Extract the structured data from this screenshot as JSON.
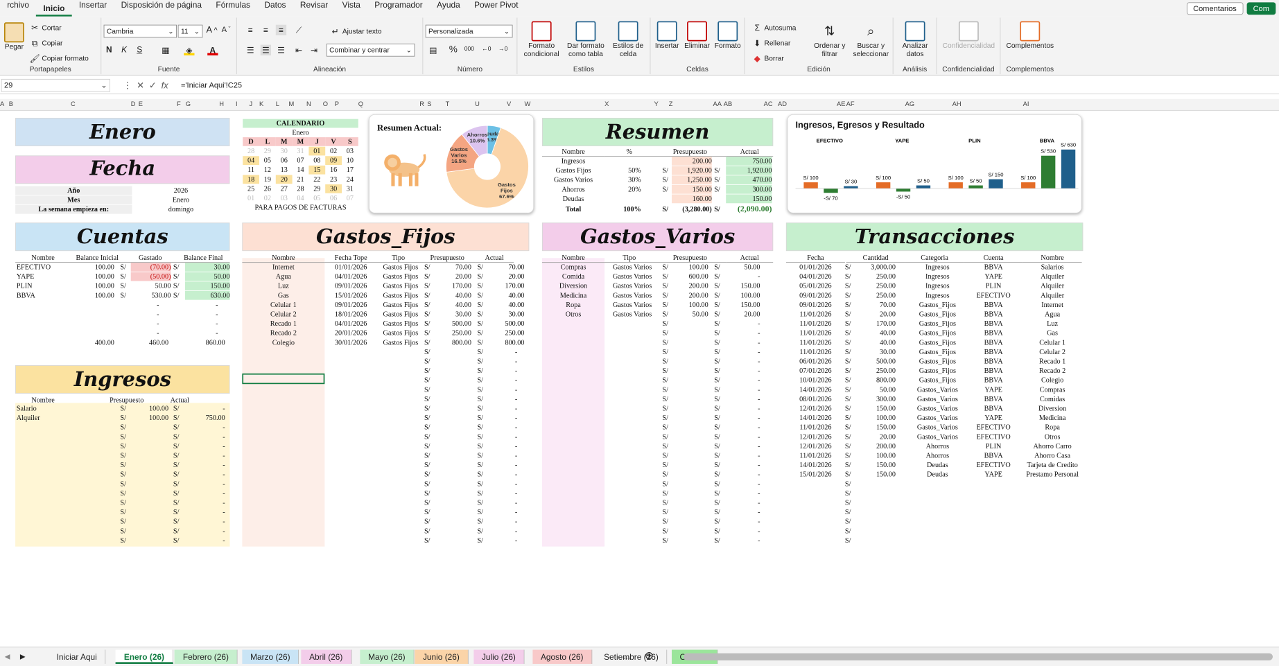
{
  "menu": [
    "rchivo",
    "Inicio",
    "Insertar",
    "Disposición de página",
    "Fórmulas",
    "Datos",
    "Revisar",
    "Vista",
    "Programador",
    "Ayuda",
    "Power Pivot"
  ],
  "topbtns": {
    "comments": "Comentarios",
    "share": "Com"
  },
  "ribbon": {
    "paste": "Pegar",
    "cut": "Cortar",
    "copy": "Copiar",
    "copy_format": "Copiar formato",
    "g_clip": "Portapapeles",
    "font": "Cambria",
    "size": "11",
    "g_font": "Fuente",
    "wrap": "Ajustar texto",
    "merge": "Combinar y centrar",
    "g_align": "Alineación",
    "numfmt": "Personalizada",
    "g_num": "Número",
    "cond": "Formato\ncondicional",
    "astable": "Dar formato\ncomo tabla",
    "cellstyles": "Estilos de\ncelda",
    "g_styles": "Estilos",
    "insert": "Insertar",
    "delete": "Eliminar",
    "format": "Formato",
    "g_cells": "Celdas",
    "autosum": "Autosuma",
    "fill": "Rellenar",
    "clear": "Borrar",
    "sort": "Ordenar y\nfiltrar",
    "find": "Buscar y\nseleccionar",
    "g_edit": "Edición",
    "analyze": "Analizar\ndatos",
    "g_analysis": "Análisis",
    "conf": "Confidencialidad",
    "g_conf": "Confidencialidad",
    "addins": "Complementos",
    "g_addins": "Complementos"
  },
  "formula": {
    "name": "29",
    "fx": "fx",
    "value": "='Iniciar Aqui'!C25"
  },
  "cols": [
    "A",
    "B",
    "C",
    "D",
    "E",
    "F",
    "G",
    "H",
    "I",
    "J",
    "K",
    "L",
    "M",
    "N",
    "O",
    "P",
    "Q",
    "R",
    "S",
    "T",
    "U",
    "V",
    "W",
    "X",
    "Y",
    "Z",
    "AA",
    "AB",
    "AC",
    "AD",
    "AE",
    "AF",
    "AG",
    "AH",
    "AI"
  ],
  "enero": "Enero",
  "fecha": {
    "title": "Fecha",
    "rows": [
      [
        "Año",
        "2026"
      ],
      [
        "Mes",
        "Enero"
      ],
      [
        "La semana empieza en:",
        "domingo"
      ]
    ]
  },
  "calendar": {
    "title": "CALENDARIO",
    "month": "Enero",
    "days": [
      "D",
      "L",
      "M",
      "M",
      "J",
      "V",
      "S"
    ],
    "weeks": [
      [
        "28",
        "29",
        "30",
        "31",
        "01",
        "02",
        "03"
      ],
      [
        "04",
        "05",
        "06",
        "07",
        "08",
        "09",
        "10"
      ],
      [
        "11",
        "12",
        "13",
        "14",
        "15",
        "16",
        "17"
      ],
      [
        "18",
        "19",
        "20",
        "21",
        "22",
        "23",
        "24"
      ],
      [
        "25",
        "26",
        "27",
        "28",
        "29",
        "30",
        "31"
      ],
      [
        "01",
        "02",
        "03",
        "04",
        "05",
        "06",
        "07"
      ]
    ],
    "footer": "PARA PAGOS DE FACTURAS"
  },
  "resumen_actual": {
    "title": "Resumen Actual:",
    "slices": [
      {
        "label": "Gastos Fijos",
        "value": 67.6,
        "color": "#fbd4a8"
      },
      {
        "label": "Gastos Varios",
        "value": 16.5,
        "color": "#f4a582"
      },
      {
        "label": "Ahorros",
        "value": 10.6,
        "color": "#dcc4ef"
      },
      {
        "label": "Deudas",
        "value": 5.3,
        "color": "#6cc0e5"
      }
    ],
    "labels": [
      "Gastos\nFijos\n67.6%",
      "Gastos\nVarios\n16.5%",
      "Ahorros\n10.6%",
      "Deudas\n5.3%"
    ]
  },
  "resumen": {
    "title": "Resumen",
    "headers": [
      "Nombre",
      "%",
      "Presupuesto",
      "Actual"
    ],
    "rows": [
      [
        "Ingresos",
        "",
        "",
        "200.00",
        "750.00"
      ],
      [
        "Gastos Fijos",
        "50%",
        "S/",
        "1,920.00",
        "1,920.00"
      ],
      [
        "Gastos Varios",
        "30%",
        "S/",
        "1,250.00",
        "470.00"
      ],
      [
        "Ahorros",
        "20%",
        "S/",
        "150.00",
        "300.00"
      ],
      [
        "Deudas",
        "",
        "",
        "160.00",
        "150.00"
      ]
    ],
    "total": [
      "Total",
      "100%",
      "S/",
      "(3,280.00)",
      "(2,090.00)"
    ]
  },
  "chart_data": {
    "type": "bar",
    "title": "Ingresos, Egresos y Resultado",
    "categories": [
      "EFECTIVO",
      "YAPE",
      "PLIN",
      "BBVA"
    ],
    "series": [
      {
        "values": [
          100,
          100,
          100,
          100
        ],
        "color": "#e46c26"
      },
      {
        "values": [
          -70,
          -50,
          50,
          530
        ],
        "color": "#2e7d32"
      },
      {
        "values": [
          30,
          50,
          150,
          630
        ],
        "color": "#1f5f8b"
      }
    ],
    "labels": [
      [
        "S/ 100",
        "-S/ 70",
        "S/ 30"
      ],
      [
        "S/ 100",
        "-S/ 50",
        "S/ 50"
      ],
      [
        "S/ 100",
        "S/ 50",
        "S/ 150"
      ],
      [
        "S/ 100",
        "S/ 530",
        "S/ 630"
      ]
    ]
  },
  "cuentas": {
    "title": "Cuentas",
    "headers": [
      "Nombre",
      "Balance Inicial",
      "Gastado",
      "Balance Final"
    ],
    "rows": [
      [
        "EFECTIVO",
        "100.00",
        "(70.00)",
        "30.00"
      ],
      [
        "YAPE",
        "100.00",
        "(50.00)",
        "50.00"
      ],
      [
        "PLIN",
        "100.00",
        "50.00",
        "150.00"
      ],
      [
        "BBVA",
        "100.00",
        "530.00",
        "630.00"
      ]
    ],
    "totals": [
      "400.00",
      "460.00",
      "860.00"
    ]
  },
  "ingresos": {
    "title": "Ingresos",
    "headers": [
      "Nombre",
      "Presupuesto",
      "Actual"
    ],
    "rows": [
      [
        "Salario",
        "100.00",
        "-"
      ],
      [
        "Alquiler",
        "100.00",
        "750.00"
      ]
    ]
  },
  "gastos_fijos": {
    "title": "Gastos_Fijos",
    "headers": [
      "Nombre",
      "Fecha Tope",
      "Tipo",
      "Presupuesto",
      "Actual"
    ],
    "rows": [
      [
        "Internet",
        "01/01/2026",
        "Gastos Fijos",
        "70.00",
        "70.00"
      ],
      [
        "Agua",
        "04/01/2026",
        "Gastos Fijos",
        "20.00",
        "20.00"
      ],
      [
        "Luz",
        "09/01/2026",
        "Gastos Fijos",
        "170.00",
        "170.00"
      ],
      [
        "Gas",
        "15/01/2026",
        "Gastos Fijos",
        "40.00",
        "40.00"
      ],
      [
        "Celular 1",
        "09/01/2026",
        "Gastos Fijos",
        "40.00",
        "40.00"
      ],
      [
        "Celular 2",
        "18/01/2026",
        "Gastos Fijos",
        "30.00",
        "30.00"
      ],
      [
        "Recado 1",
        "04/01/2026",
        "Gastos Fijos",
        "500.00",
        "500.00"
      ],
      [
        "Recado 2",
        "20/01/2026",
        "Gastos Fijos",
        "250.00",
        "250.00"
      ],
      [
        "Colegio",
        "30/01/2026",
        "Gastos Fijos",
        "800.00",
        "800.00"
      ]
    ]
  },
  "gastos_varios": {
    "title": "Gastos_Varios",
    "headers": [
      "Nombre",
      "Tipo",
      "Presupuesto",
      "Actual"
    ],
    "rows": [
      [
        "Compras",
        "Gastos Varios",
        "100.00",
        "50.00"
      ],
      [
        "Comida",
        "Gastos Varios",
        "600.00",
        "-"
      ],
      [
        "Diversion",
        "Gastos Varios",
        "200.00",
        "150.00"
      ],
      [
        "Medicina",
        "Gastos Varios",
        "200.00",
        "100.00"
      ],
      [
        "Ropa",
        "Gastos Varios",
        "100.00",
        "150.00"
      ],
      [
        "Otros",
        "Gastos Varios",
        "50.00",
        "20.00"
      ]
    ]
  },
  "transacciones": {
    "title": "Transacciones",
    "headers": [
      "Fecha",
      "Cantidad",
      "Categoria",
      "Cuenta",
      "Nombre"
    ],
    "rows": [
      [
        "01/01/2026",
        "3,000.00",
        "Ingresos",
        "BBVA",
        "Salarios"
      ],
      [
        "04/01/2026",
        "250.00",
        "Ingresos",
        "YAPE",
        "Alquiler"
      ],
      [
        "05/01/2026",
        "250.00",
        "Ingresos",
        "PLIN",
        "Alquiler"
      ],
      [
        "09/01/2026",
        "250.00",
        "Ingresos",
        "EFECTIVO",
        "Alquiler"
      ],
      [
        "09/01/2026",
        "70.00",
        "Gastos_Fijos",
        "BBVA",
        "Internet"
      ],
      [
        "11/01/2026",
        "20.00",
        "Gastos_Fijos",
        "BBVA",
        "Agua"
      ],
      [
        "11/01/2026",
        "170.00",
        "Gastos_Fijos",
        "BBVA",
        "Luz"
      ],
      [
        "11/01/2026",
        "40.00",
        "Gastos_Fijos",
        "BBVA",
        "Gas"
      ],
      [
        "11/01/2026",
        "40.00",
        "Gastos_Fijos",
        "BBVA",
        "Celular 1"
      ],
      [
        "11/01/2026",
        "30.00",
        "Gastos_Fijos",
        "BBVA",
        "Celular 2"
      ],
      [
        "06/01/2026",
        "500.00",
        "Gastos_Fijos",
        "BBVA",
        "Recado 1"
      ],
      [
        "07/01/2026",
        "250.00",
        "Gastos_Fijos",
        "BBVA",
        "Recado 2"
      ],
      [
        "10/01/2026",
        "800.00",
        "Gastos_Fijos",
        "BBVA",
        "Colegio"
      ],
      [
        "14/01/2026",
        "50.00",
        "Gastos_Varios",
        "YAPE",
        "Compras"
      ],
      [
        "08/01/2026",
        "300.00",
        "Gastos_Varios",
        "BBVA",
        "Comidas"
      ],
      [
        "12/01/2026",
        "150.00",
        "Gastos_Varios",
        "BBVA",
        "Diversion"
      ],
      [
        "14/01/2026",
        "100.00",
        "Gastos_Varios",
        "YAPE",
        "Medicina"
      ],
      [
        "11/01/2026",
        "150.00",
        "Gastos_Varios",
        "EFECTIVO",
        "Ropa"
      ],
      [
        "12/01/2026",
        "20.00",
        "Gastos_Varios",
        "EFECTIVO",
        "Otros"
      ],
      [
        "12/01/2026",
        "200.00",
        "Ahorros",
        "PLIN",
        "Ahorro Carro"
      ],
      [
        "11/01/2026",
        "100.00",
        "Ahorros",
        "BBVA",
        "Ahorro Casa"
      ],
      [
        "14/01/2026",
        "150.00",
        "Deudas",
        "EFECTIVO",
        "Tarjeta de Credito"
      ],
      [
        "15/01/2026",
        "150.00",
        "Deudas",
        "YAPE",
        "Prestamo Personal"
      ]
    ]
  },
  "currency": "S/",
  "dash": "-",
  "tabs": [
    {
      "label": "Iniciar Aqui",
      "color": "#f3f3f3"
    },
    {
      "label": "Enero (26)",
      "color": "#ffffff",
      "active": true
    },
    {
      "label": "Febrero (26)",
      "color": "#c6efce"
    },
    {
      "label": "Marzo (26)",
      "color": "#c9e4f5"
    },
    {
      "label": "Abril (26)",
      "color": "#f3cdea"
    },
    {
      "label": "Mayo (26)",
      "color": "#c6efce"
    },
    {
      "label": "Junio (26)",
      "color": "#fbd4a8"
    },
    {
      "label": "Julio (26)",
      "color": "#f3cdea"
    },
    {
      "label": "Agosto (26)",
      "color": "#f8c9c9"
    },
    {
      "label": "Setiembre (26)",
      "color": "#f3f3f3"
    },
    {
      "label": "Octubre",
      "color": "#9be59b"
    }
  ],
  "tabs_more": "..."
}
